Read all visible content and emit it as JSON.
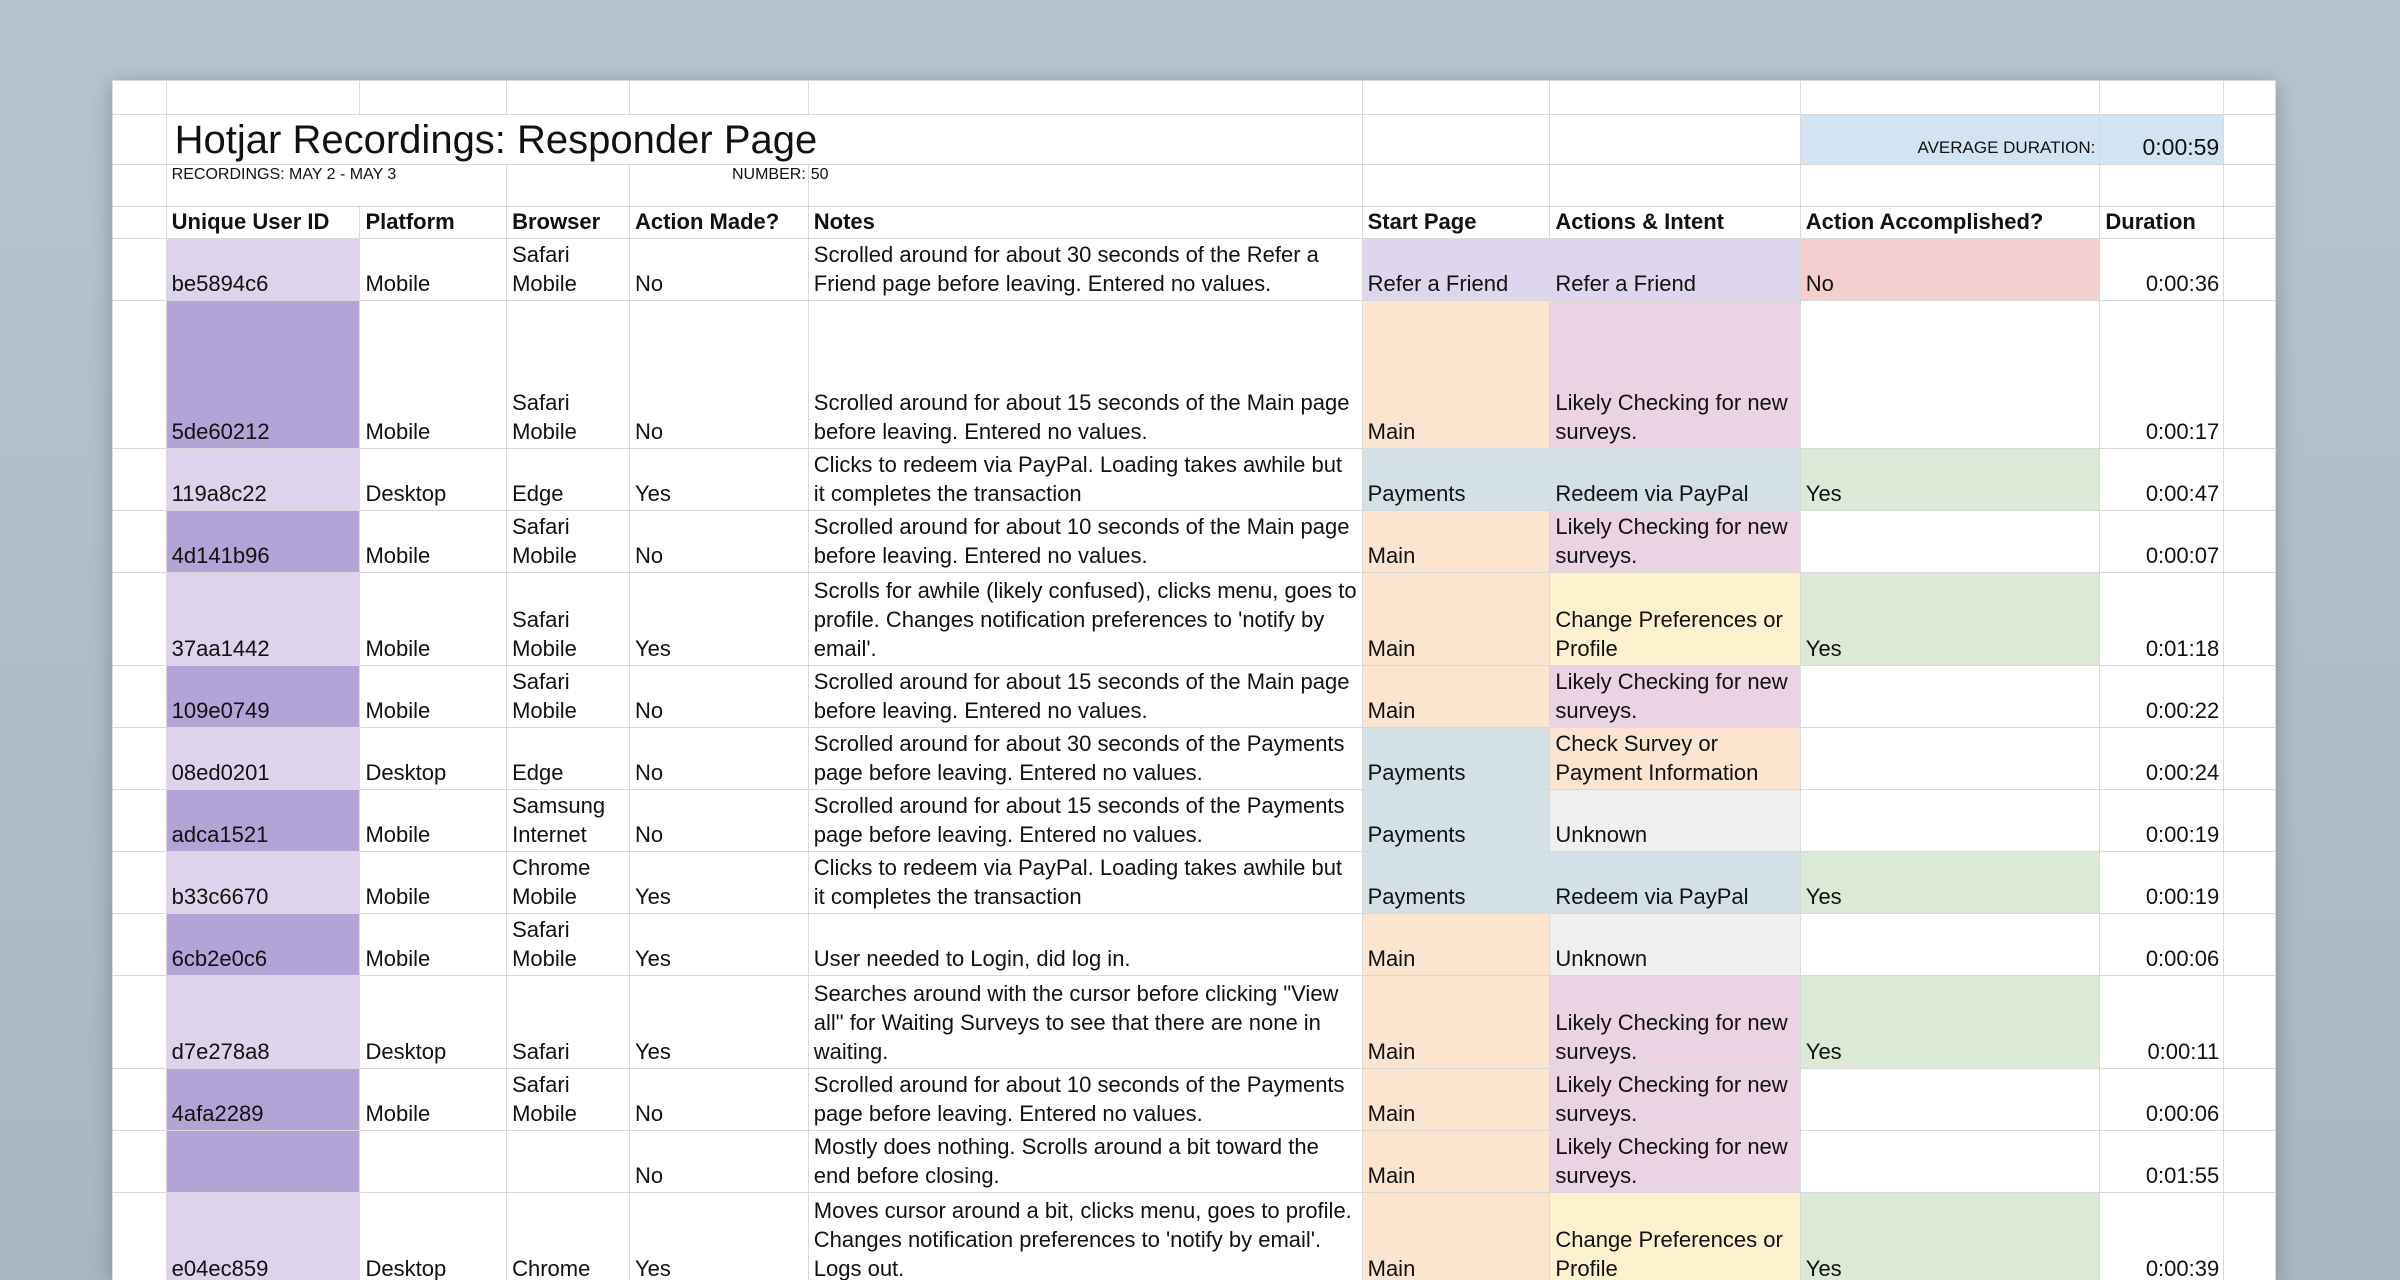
{
  "header": {
    "title": "Hotjar Recordings: Responder Page",
    "recordings_label": "RECORDINGS: MAY 2 - MAY 3",
    "number_label": "NUMBER:",
    "number_value": "50",
    "avg_label": "AVERAGE DURATION:",
    "avg_value": "0:00:59"
  },
  "columns": [
    "Unique User ID",
    "Platform",
    "Browser",
    "Action Made?",
    "Notes",
    "Start Page",
    "Actions & Intent",
    "Action Accomplished?",
    "Duration"
  ],
  "rows": [
    {
      "id": "be5894c6",
      "platform": "Mobile",
      "browser": "Safari Mobile",
      "action": "No",
      "notes": "Scrolled around for about 30 seconds of the Refer a Friend page before leaving. Entered no values.",
      "start": "Refer a Friend",
      "intent": "Refer a Friend",
      "accomplished": "No",
      "duration": "0:00:36"
    },
    {
      "id": "5de60212",
      "platform": "Mobile",
      "browser": "Safari Mobile",
      "action": "No",
      "notes": "Scrolled around for about 15 seconds of the Main page before leaving. Entered no values.",
      "start": "Main",
      "intent": "Likely Checking for new surveys.",
      "accomplished": "",
      "duration": "0:00:17"
    },
    {
      "id": "119a8c22",
      "platform": "Desktop",
      "browser": "Edge",
      "action": "Yes",
      "notes": "Clicks to redeem via PayPal. Loading takes awhile but it completes the transaction",
      "start": "Payments",
      "intent": "Redeem via PayPal",
      "accomplished": "Yes",
      "duration": "0:00:47"
    },
    {
      "id": "4d141b96",
      "platform": "Mobile",
      "browser": "Safari Mobile",
      "action": "No",
      "notes": "Scrolled around for about 10 seconds of the Main page before leaving. Entered no values.",
      "start": "Main",
      "intent": "Likely Checking for new surveys.",
      "accomplished": "",
      "duration": "0:00:07"
    },
    {
      "id": "37aa1442",
      "platform": "Mobile",
      "browser": "Safari Mobile",
      "action": "Yes",
      "notes": "Scrolls for awhile (likely confused), clicks menu, goes to profile. Changes notification preferences to 'notify by email'.",
      "start": "Main",
      "intent": "Change Preferences or Profile",
      "accomplished": "Yes",
      "duration": "0:01:18"
    },
    {
      "id": "109e0749",
      "platform": "Mobile",
      "browser": "Safari Mobile",
      "action": "No",
      "notes": "Scrolled around for about 15 seconds of the Main page before leaving. Entered no values.",
      "start": "Main",
      "intent": "Likely Checking for new surveys.",
      "accomplished": "",
      "duration": "0:00:22"
    },
    {
      "id": "08ed0201",
      "platform": "Desktop",
      "browser": "Edge",
      "action": "No",
      "notes": "Scrolled around for about 30 seconds of the Payments page before leaving. Entered no values.",
      "start": "Payments",
      "intent": "Check Survey or Payment Information",
      "accomplished": "",
      "duration": "0:00:24"
    },
    {
      "id": "adca1521",
      "platform": "Mobile",
      "browser": "Samsung Internet",
      "action": "No",
      "notes": "Scrolled around for about 15 seconds of the Payments page before leaving. Entered no values.",
      "start": "Payments",
      "intent": "Unknown",
      "accomplished": "",
      "duration": "0:00:19"
    },
    {
      "id": "b33c6670",
      "platform": "Mobile",
      "browser": "Chrome Mobile",
      "action": "Yes",
      "notes": "Clicks to redeem via PayPal. Loading takes awhile but it completes the transaction",
      "start": "Payments",
      "intent": "Redeem via PayPal",
      "accomplished": "Yes",
      "duration": "0:00:19"
    },
    {
      "id": "6cb2e0c6",
      "platform": "Mobile",
      "browser": "Safari Mobile",
      "action": "Yes",
      "notes": "User needed to Login, did log in.",
      "start": "Main",
      "intent": "Unknown",
      "accomplished": "",
      "duration": "0:00:06"
    },
    {
      "id": "d7e278a8",
      "platform": "Desktop",
      "browser": "Safari",
      "action": "Yes",
      "notes": "Searches around with the cursor before clicking \"View all\" for Waiting Surveys to see that there are none in waiting.",
      "start": "Main",
      "intent": "Likely Checking for new surveys.",
      "accomplished": "Yes",
      "duration": "0:00:11"
    },
    {
      "id": "4afa2289",
      "platform": "Mobile",
      "browser": "Safari Mobile",
      "action": "No",
      "notes": "Scrolled around for about 10 seconds of the Payments page before leaving. Entered no values.",
      "start": "Main",
      "intent": "Likely Checking for new surveys.",
      "accomplished": "",
      "duration": "0:00:06"
    },
    {
      "id": "",
      "platform": "",
      "browser": "",
      "action": "No",
      "notes": "Mostly does nothing. Scrolls around a bit toward the end before closing.",
      "start": "Main",
      "intent": "Likely Checking for new surveys.",
      "accomplished": "",
      "duration": "0:01:55"
    },
    {
      "id": "e04ec859",
      "platform": "Desktop",
      "browser": "Chrome",
      "action": "Yes",
      "notes": "Moves cursor around a bit, clicks menu, goes to profile. Changes notification preferences to 'notify by email'. Logs out.",
      "start": "Main",
      "intent": "Change Preferences or Profile",
      "accomplished": "Yes",
      "duration": "0:00:39"
    }
  ]
}
